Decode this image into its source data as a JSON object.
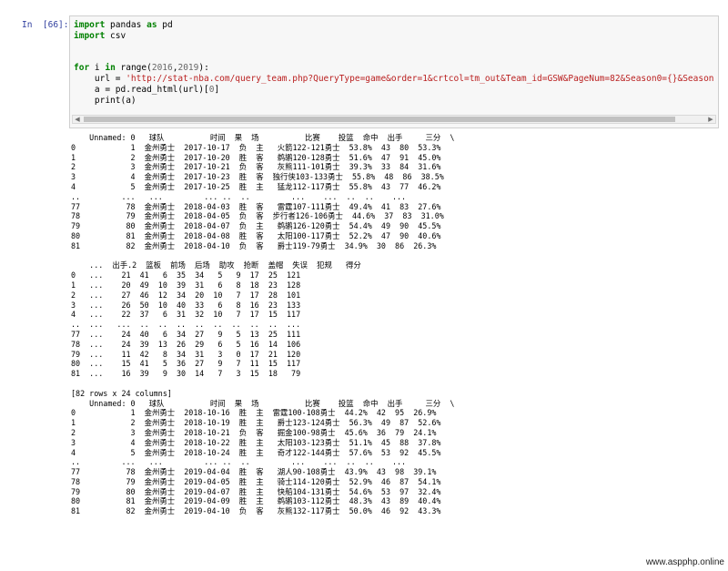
{
  "cell": {
    "prompt": "In  [66]:",
    "code_lines": [
      [
        {
          "t": "import",
          "c": "kw"
        },
        {
          "t": " pandas "
        },
        {
          "t": "as",
          "c": "kw"
        },
        {
          "t": " pd"
        }
      ],
      [
        {
          "t": "import",
          "c": "kw"
        },
        {
          "t": " csv"
        }
      ],
      [
        {
          "t": ""
        }
      ],
      [
        {
          "t": ""
        }
      ],
      [
        {
          "t": "for",
          "c": "kw"
        },
        {
          "t": " i "
        },
        {
          "t": "in",
          "c": "kw"
        },
        {
          "t": " range("
        },
        {
          "t": "2016",
          "c": "num"
        },
        {
          "t": ","
        },
        {
          "t": "2019",
          "c": "num"
        },
        {
          "t": "):"
        }
      ],
      [
        {
          "t": "    url = "
        },
        {
          "t": "'http://stat-nba.com/query_team.php?QueryType=game&order=1&crtcol=tm_out&Team_id=GSW&PageNum=82&Season0={}&Season1={}'",
          "c": "str"
        },
        {
          "t": ".form"
        }
      ],
      [
        {
          "t": "    a = pd.read_html(url)["
        },
        {
          "t": "0",
          "c": "num"
        },
        {
          "t": "]"
        }
      ],
      [
        {
          "t": "    print(a)"
        }
      ]
    ]
  },
  "output_text": "    Unnamed: 0   球队          时间  果  场          比赛    投篮  命中  出手     三分  \\\n0            1  金州勇士  2017-10-17  负  主   火箭122-121勇士  53.8%  43  80  53.3%\n1            2  金州勇士  2017-10-20  胜  客   鹈鹕120-128勇士  51.6%  47  91  45.0%\n2            3  金州勇士  2017-10-21  负  客   灰熊111-101勇士  39.3%  33  84  31.6%\n3            4  金州勇士  2017-10-23  胜  客  独行侠103-133勇士  55.8%  48  86  38.5%\n4            5  金州勇士  2017-10-25  胜  主   猛龙112-117勇士  55.8%  43  77  46.2%\n..         ...   ...         ... ..  ..         ...    ...  ..  ..    ...\n77          78  金州勇士  2018-04-03  胜  客   雷霆107-111勇士  49.4%  41  83  27.6%\n78          79  金州勇士  2018-04-05  负  客  步行者126-106勇士  44.6%  37  83  31.0%\n79          80  金州勇士  2018-04-07  负  主   鹈鹕126-120勇士  54.4%  49  90  45.5%\n80          81  金州勇士  2018-04-08  胜  客   太阳100-117勇士  52.2%  47  90  40.6%\n81          82  金州勇士  2018-04-10  负  客   爵士119-79勇士  34.9%  30  86  26.3%\n\n    ...  出手.2  篮板  前场  后场  助攻  抢断  盖帽  失误  犯规   得分\n0   ...    21  41   6  35  34   5   9  17  25  121\n1   ...    20  49  10  39  31   6   8  18  23  128\n2   ...    27  46  12  34  20  10   7  17  28  101\n3   ...    26  50  10  40  33   6   8  16  23  133\n4   ...    22  37   6  31  32  10   7  17  15  117\n..  ...   ...  ..  ..  ..  ..  ..  ..  ..  ..  ...\n77  ...    24  40   6  34  27   9   5  13  25  111\n78  ...    24  39  13  26  29   6   5  16  14  106\n79  ...    11  42   8  34  31   3   0  17  21  120\n80  ...    15  41   5  36  27   9   7  11  15  117\n81  ...    16  39   9  30  14   7   3  15  18   79\n\n[82 rows x 24 columns]\n    Unnamed: 0   球队          时间  果  场          比赛    投篮  命中  出手     三分  \\\n0            1  金州勇士  2018-10-16  胜  主  雷霆100-108勇士  44.2%  42  95  26.9%\n1            2  金州勇士  2018-10-19  胜  主   爵士123-124勇士  56.3%  49  87  52.6%\n2            3  金州勇士  2018-10-21  负  客   掘金100-98勇士  45.6%  36  79  24.1%\n3            4  金州勇士  2018-10-22  胜  主   太阳103-123勇士  51.1%  45  88  37.8%\n4            5  金州勇士  2018-10-24  胜  主   奇才122-144勇士  57.6%  53  92  45.5%\n..         ...   ...         ... ..  ..         ...    ...  ..  ..    ...\n77          78  金州勇士  2019-04-04  胜  客   湖人90-108勇士  43.9%  43  98  39.1%\n78          79  金州勇士  2019-04-05  胜  主   骑士114-120勇士  52.9%  46  87  54.1%\n79          80  金州勇士  2019-04-07  胜  主   快船104-131勇士  54.6%  53  97  32.4%\n80          81  金州勇士  2019-04-09  胜  主   鹈鹕103-112勇士  48.3%  43  89  40.4%\n81          82  金州勇士  2019-04-10  负  客   灰熊132-117勇士  50.0%  46  92  43.3%",
  "watermark": "www.aspphp.online",
  "colors": {
    "prompt": "#303f9f",
    "keyword": "#008000",
    "string": "#ba2121",
    "number": "#666666",
    "cell_bg": "#f7f7f7"
  },
  "icons": {
    "scroll_left": "triangle-left",
    "scroll_right": "triangle-right"
  }
}
